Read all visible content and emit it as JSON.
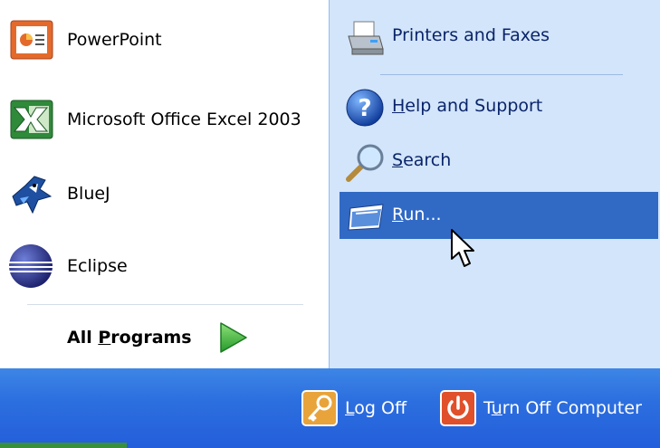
{
  "left_panel": {
    "programs": [
      {
        "label": "PowerPoint",
        "icon": "powerpoint-icon"
      },
      {
        "label": "Microsoft Office Excel 2003",
        "icon": "excel-icon"
      },
      {
        "label": "BlueJ",
        "icon": "bluej-icon"
      },
      {
        "label": "Eclipse",
        "icon": "eclipse-icon"
      }
    ],
    "all_programs_prefix": "All ",
    "all_programs_underlined": "P",
    "all_programs_suffix": "rograms"
  },
  "right_panel": {
    "printers": {
      "label": "Printers and Faxes",
      "icon": "printer-icon"
    },
    "help": {
      "underlined": "H",
      "rest": "elp and Support",
      "icon": "help-icon"
    },
    "search": {
      "underlined": "S",
      "rest": "earch",
      "icon": "search-icon"
    },
    "run": {
      "underlined": "R",
      "rest": "un...",
      "icon": "run-icon"
    }
  },
  "taskbar": {
    "logoff": {
      "underlined": "L",
      "rest": "og Off",
      "icon": "key-icon"
    },
    "turnoff": {
      "prefix": "T",
      "underlined": "u",
      "rest": "rn Off Computer",
      "icon": "power-icon"
    }
  },
  "colors": {
    "accent": "#316ac5",
    "right_bg": "#d3e5fa",
    "taskbar": "#245edb"
  }
}
